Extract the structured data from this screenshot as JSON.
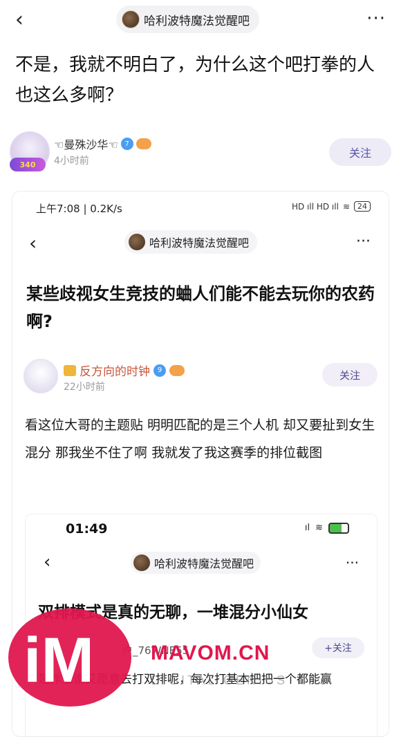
{
  "nav": {
    "back_icon": "‹",
    "forum_name": "哈利波特魔法觉醒吧",
    "more_icon": "···"
  },
  "post": {
    "title": "不是，我就不明白了，为什么这个吧打拳的人也这么多啊？",
    "author": {
      "name": "☜曼殊沙华☜",
      "level": "7",
      "time": "4小时前",
      "avatar_badge": "340"
    },
    "follow_label": "关注"
  },
  "screenshot": {
    "status_left": "上午7:08 | 0.2K/s",
    "status_right": "HD ıll HD ıll",
    "battery": "24",
    "forum_name": "哈利波特魔法觉醒吧",
    "title": "某些歧视女生竞技的蛐人们能不能去玩你的农药啊?",
    "author": {
      "name": "反方向的时钟",
      "time": "22小时前"
    },
    "follow_label": "关注",
    "body": "看这位大哥的主题贴 明明匹配的是三个人机 却又要扯到女生混分 那我坐不住了啊 我就发了我这赛季的排位截图",
    "nested": {
      "time": "01:49",
      "forum_name": "哈利波特魔法觉醒吧",
      "title": "双排模式是真的无聊，一堆混分小仙女",
      "user": "户_76WNE55",
      "follow_label": "+关注",
      "body": "是作业谁又愿意去打双排呢，每次打基本把把一个都能赢"
    }
  },
  "watermark": {
    "logo": "iM",
    "site": "MAVOM.CN",
    "sub": "DIGITAL GENIUS"
  },
  "colors": {
    "accent": "#5a54a8",
    "watermark_red": "#e0174e"
  }
}
